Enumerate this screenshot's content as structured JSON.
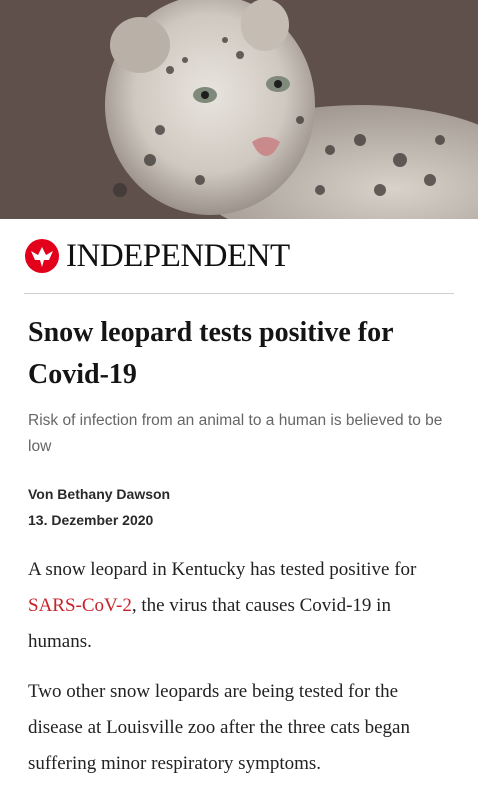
{
  "hero": {
    "image_alt": "snow-leopard-photo"
  },
  "brand": {
    "name": "INDEPENDENT",
    "icon": "eagle-logo-icon",
    "color": "#e2001a"
  },
  "article": {
    "headline": "Snow leopard tests positive for Covid-19",
    "standfirst": "Risk of infection from an animal to a human is believed to be low",
    "byline": "Von Bethany Dawson",
    "date": "13. Dezember 2020",
    "para1_before": "A snow leopard in Kentucky has tested positive for ",
    "para1_link": "SARS-CoV-2",
    "para1_after": ", the virus that causes Covid-19 in humans.",
    "para2": " Two other snow leopards are being tested for the disease at Louisville zoo after the three cats began suffering minor respiratory symptoms."
  },
  "colors": {
    "link": "#c7222a",
    "text": "#222222",
    "standfirst": "#666666"
  }
}
